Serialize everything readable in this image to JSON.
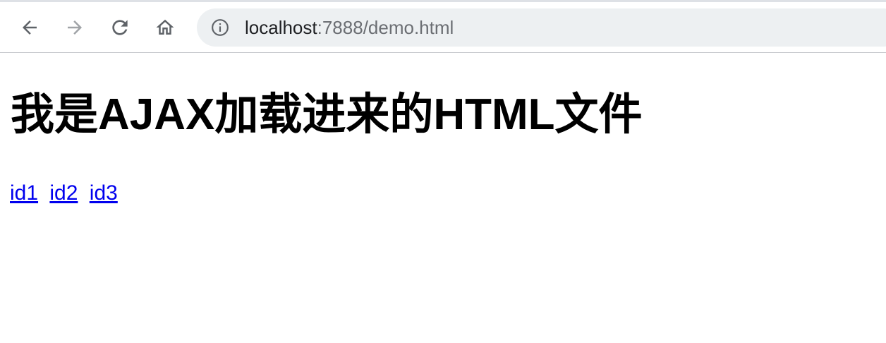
{
  "browser": {
    "url_host": "localhost",
    "url_rest": ":7888/demo.html",
    "icons": {
      "back": "arrow-left-icon",
      "forward": "arrow-right-icon",
      "reload": "reload-icon",
      "home": "home-icon",
      "info": "info-icon"
    },
    "colors": {
      "nav_icon": "#5f6368",
      "nav_icon_disabled": "#a0a3a7",
      "omnibox_bg": "#edf0f2"
    }
  },
  "page": {
    "heading": "我是AJAX加载进来的HTML文件",
    "links": [
      {
        "label": "id1"
      },
      {
        "label": "id2"
      },
      {
        "label": "id3"
      }
    ],
    "link_color": "#0000ee"
  }
}
